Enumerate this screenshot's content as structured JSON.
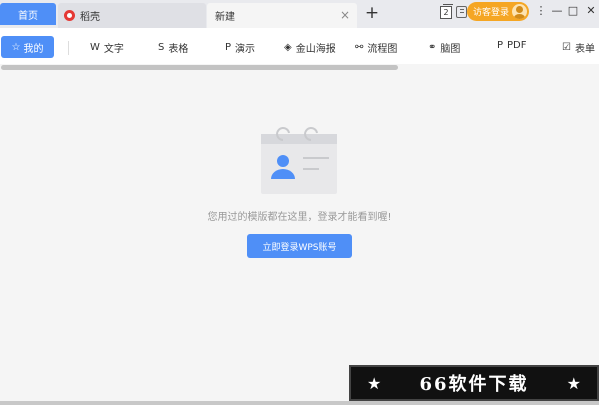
{
  "tabs": {
    "home": "首页",
    "daoke": "稻壳",
    "new_tab": "新建",
    "close": "×",
    "add": "+"
  },
  "titlebar": {
    "window_count": "2",
    "visitor_login": "访客登录",
    "menu": "⋮",
    "minimize": "—",
    "maximize": "□",
    "close": "✕"
  },
  "toolbar": {
    "mine": "我的",
    "items": [
      {
        "icon": "W",
        "label": "文字"
      },
      {
        "icon": "S",
        "label": "表格"
      },
      {
        "icon": "P",
        "label": "演示"
      },
      {
        "icon": "◈",
        "label": "金山海报"
      },
      {
        "icon": "⚯",
        "label": "流程图"
      },
      {
        "icon": "⚭",
        "label": "脑图"
      },
      {
        "icon": "P",
        "label": "PDF"
      },
      {
        "icon": "☑",
        "label": "表单"
      }
    ]
  },
  "main": {
    "empty_message": "您用过的模版都在这里，登录才能看到喔!",
    "login_button": "立即登录WPS账号"
  },
  "banner": {
    "star_left": "★",
    "title": "66软件下载",
    "star_right": "★"
  },
  "colors": {
    "accent": "#4f8ff7",
    "login_orange": "#f5a623",
    "background": "#f5f5f5"
  }
}
